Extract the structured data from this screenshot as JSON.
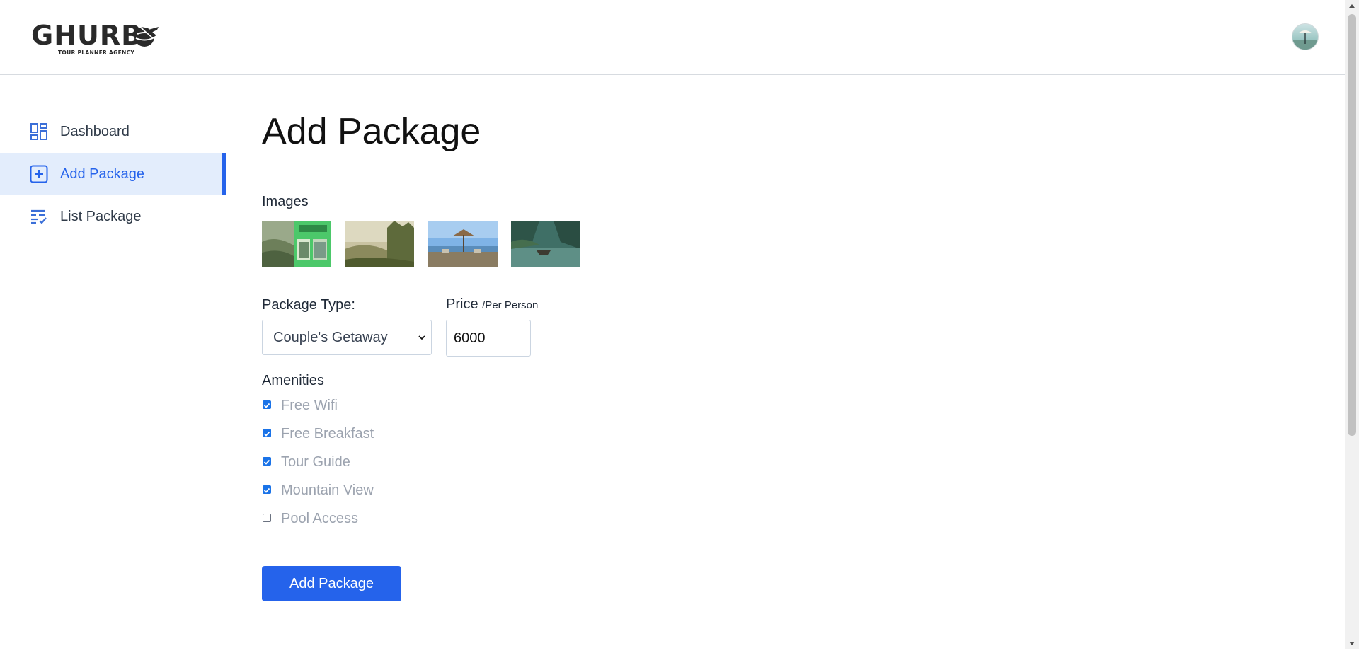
{
  "brand": {
    "name": "GHURB",
    "tagline": "TOUR PLANNER AGENCY"
  },
  "colors": {
    "accent": "#2563eb",
    "active_bg": "#e3edfc"
  },
  "sidebar": {
    "items": [
      {
        "label": "Dashboard",
        "icon": "dashboard-icon"
      },
      {
        "label": "Add Package",
        "icon": "add-box-icon",
        "active": true
      },
      {
        "label": "List Package",
        "icon": "list-check-icon"
      }
    ]
  },
  "main": {
    "title": "Add Package",
    "images_label": "Images",
    "package_type": {
      "label": "Package Type:",
      "value": "Couple's Getaway"
    },
    "price": {
      "label": "Price",
      "suffix": "/Per Person",
      "value": "6000"
    },
    "amenities": {
      "label": "Amenities",
      "items": [
        {
          "label": "Free Wifi",
          "checked": true
        },
        {
          "label": "Free Breakfast",
          "checked": true
        },
        {
          "label": "Tour Guide",
          "checked": true
        },
        {
          "label": "Mountain View",
          "checked": true
        },
        {
          "label": "Pool Access",
          "checked": false
        }
      ]
    },
    "submit_label": "Add Package"
  }
}
